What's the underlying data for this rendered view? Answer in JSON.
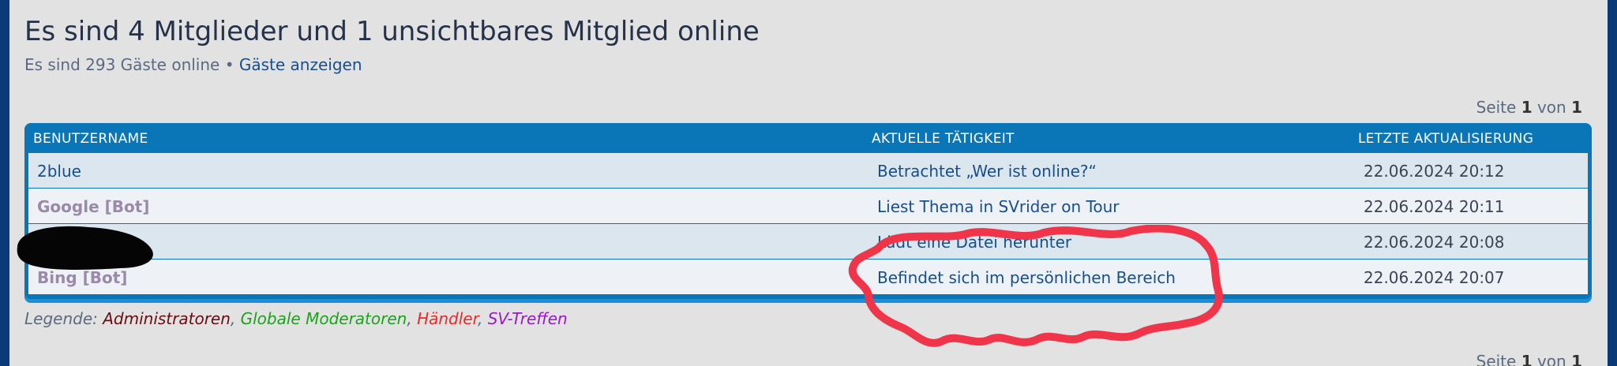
{
  "header": {
    "title": "Es sind 4 Mitglieder und 1 unsichtbares Mitglied online",
    "guests_text": "Es sind 293 Gäste online",
    "guests_sep": "•",
    "guests_link": "Gäste anzeigen"
  },
  "pagination": {
    "prefix": "Seite",
    "current": "1",
    "of": "von",
    "total": "1"
  },
  "table": {
    "columns": [
      "BENUTZERNAME",
      "AKTUELLE TÄTIGKEIT",
      "LETZTE AKTUALISIERUNG"
    ],
    "rows": [
      {
        "user": "2blue",
        "activity": "Betrachtet „Wer ist online?“",
        "time": "22.06.2024 20:12"
      },
      {
        "user": "Google [Bot]",
        "activity": "Liest Thema in SVrider on Tour",
        "time": "22.06.2024 20:11"
      },
      {
        "user": "",
        "activity": "Lädt eine Datei herunter",
        "time": "22.06.2024 20:08"
      },
      {
        "user": "Bing [Bot]",
        "activity": "Befindet sich im persönlichen Bereich",
        "time": "22.06.2024 20:07"
      }
    ]
  },
  "legend": {
    "label": "Legende:",
    "items": [
      "Administratoren",
      "Globale Moderatoren",
      "Händler",
      "SV-Treffen"
    ],
    "colors": [
      "#6a0a12",
      "#1aa31a",
      "#ea2a2a",
      "#9a1ac8"
    ]
  },
  "colors": {
    "header_bar": "#0a76b7",
    "link": "#174f8c",
    "bot": "#9a8aa8",
    "annotation": "#f0344a"
  }
}
